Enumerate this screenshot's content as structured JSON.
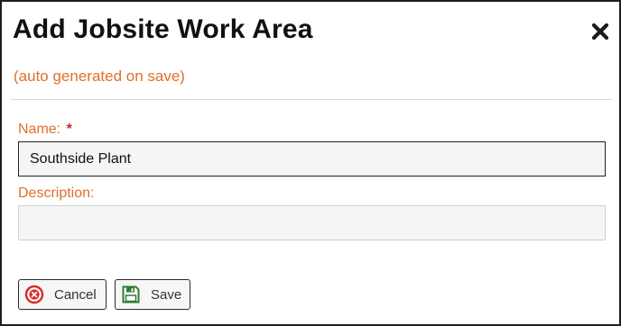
{
  "dialog": {
    "title": "Add Jobsite Work Area",
    "subtitle": "(auto generated on save)",
    "close_icon": "close-icon"
  },
  "form": {
    "name": {
      "label": "Name:",
      "required_marker": "*",
      "value": "Southside Plant"
    },
    "description": {
      "label": "Description:",
      "value": ""
    }
  },
  "buttons": {
    "cancel": {
      "label": "Cancel",
      "icon": "cancel-circle-icon"
    },
    "save": {
      "label": "Save",
      "icon": "floppy-disk-icon"
    }
  },
  "colors": {
    "accent": "#e0702b",
    "required": "#c62828",
    "cancel_icon": "#d32f2f",
    "save_icon": "#2e7d32"
  }
}
